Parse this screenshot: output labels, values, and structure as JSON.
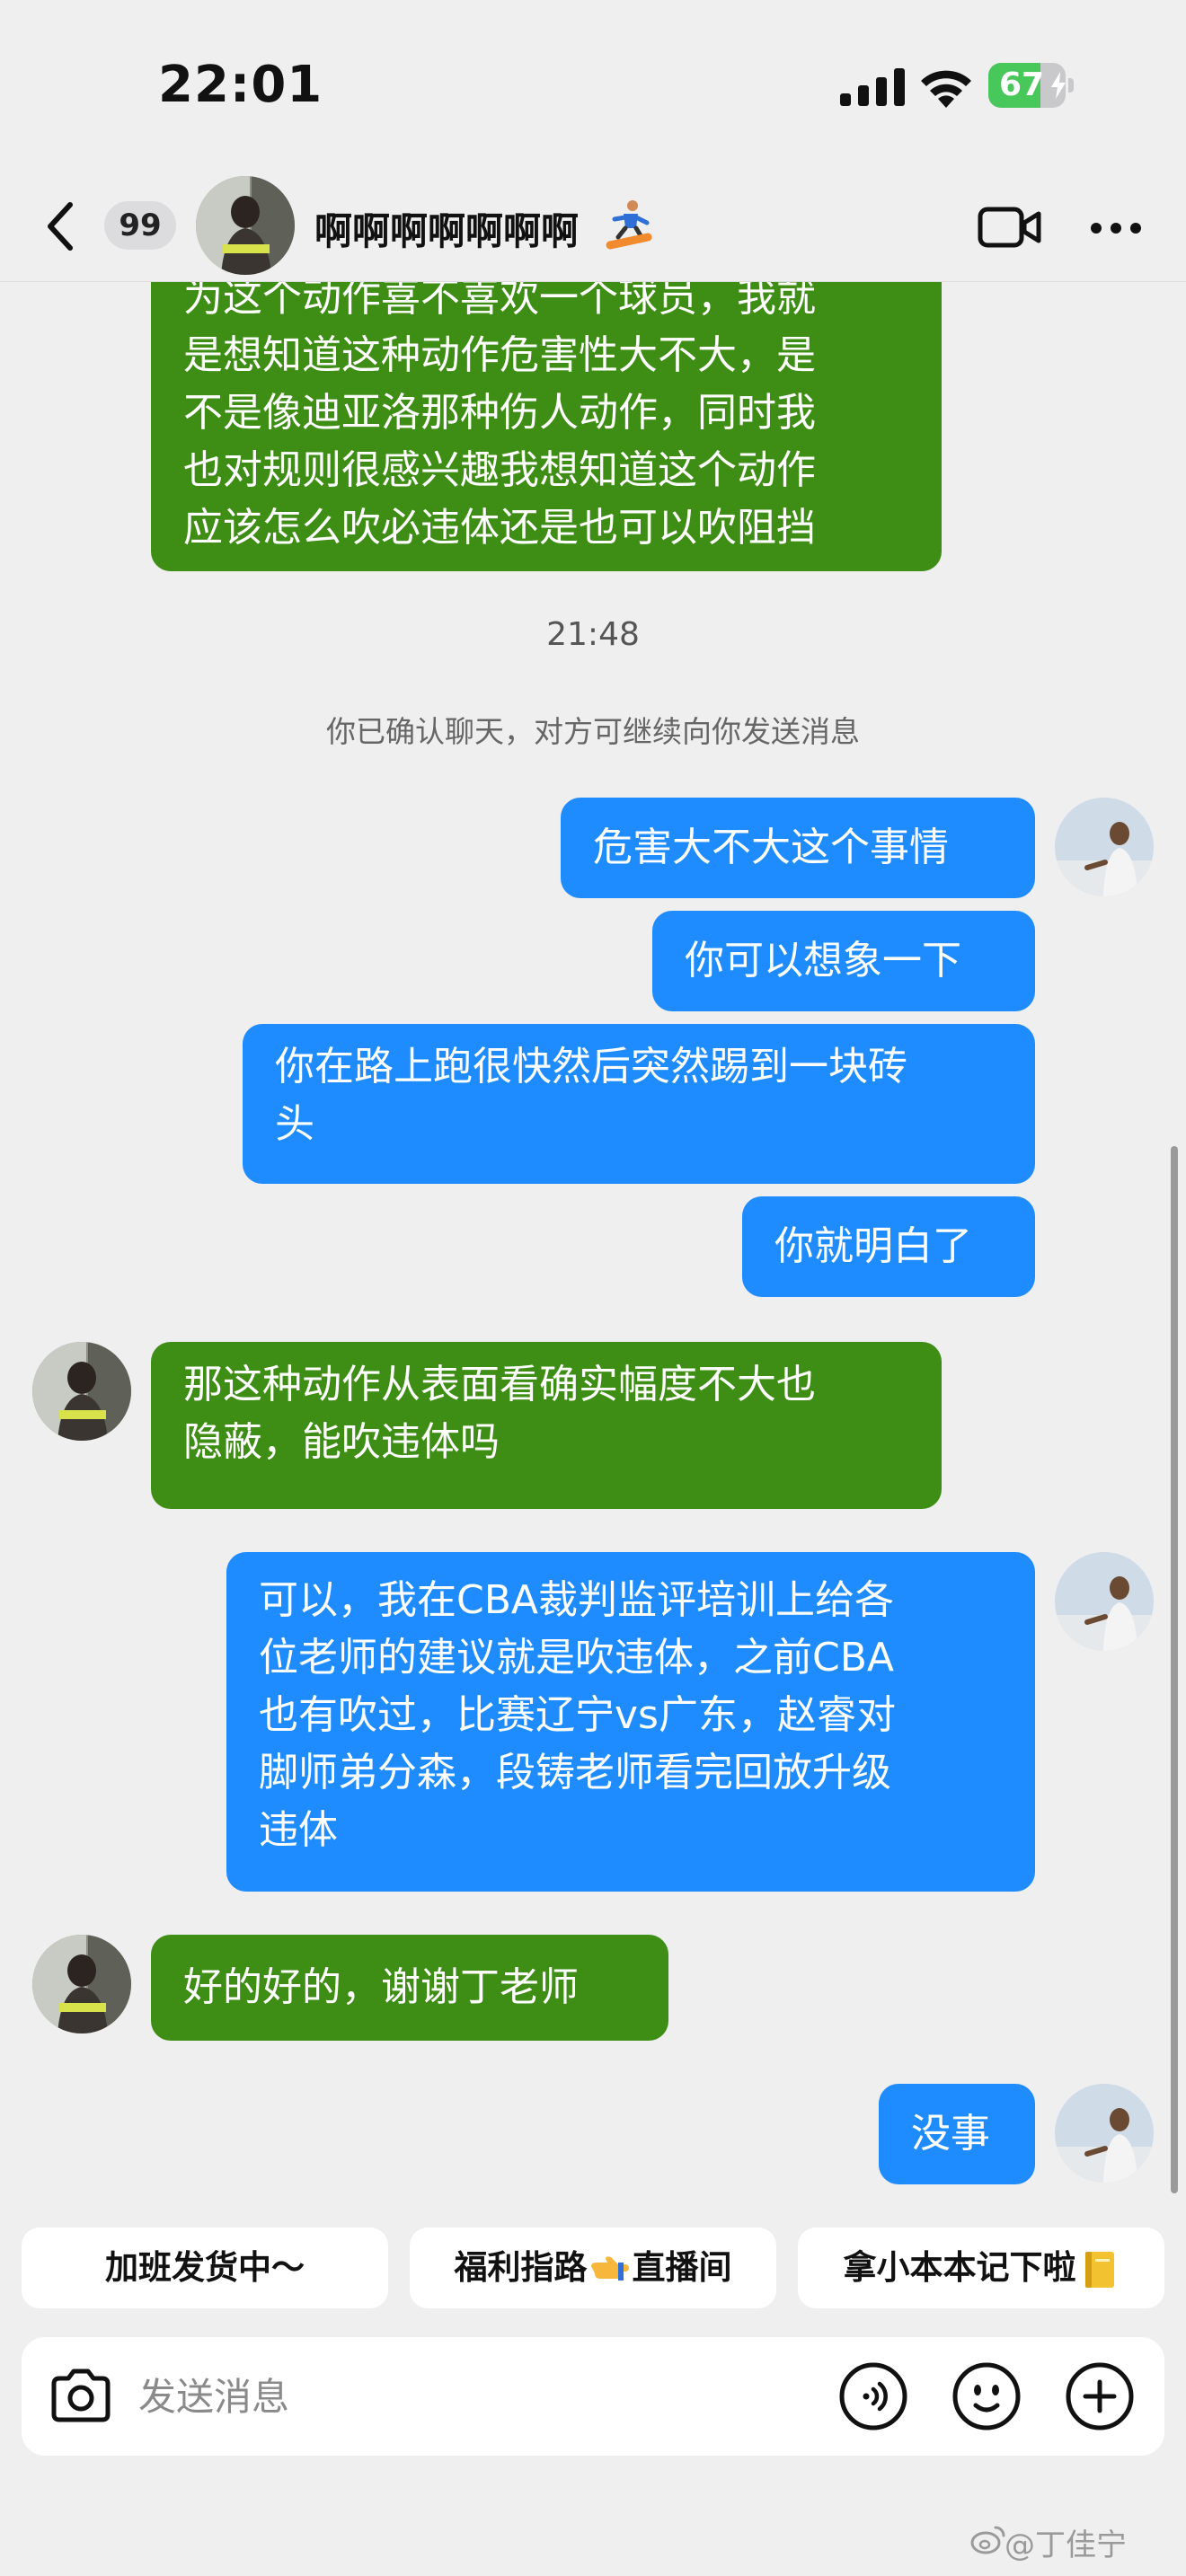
{
  "status_bar": {
    "time": "22:01",
    "battery_percent": "67",
    "battery_level": 0.67,
    "icons": [
      "signal-icon",
      "wifi-icon",
      "battery-icon"
    ]
  },
  "header": {
    "unread_count": "99",
    "contact_name": "啊啊啊啊啊啊啊",
    "icons": [
      "back-icon",
      "snowboard-icon",
      "video-call-icon",
      "more-icon"
    ]
  },
  "colors": {
    "received_bubble": "#3e8d14",
    "sent_bubble": "#1e8cff",
    "background": "#efeff0"
  },
  "chat": {
    "prev_message_lines": [
      "为这个动作喜不喜欢一个球员，我就",
      "是想知道这种动作危害性大不大，是",
      "不是像迪亚洛那种伤人动作，同时我",
      "也对规则很感兴趣我想知道这个动作",
      "应该怎么吹必违体还是也可以吹阻挡"
    ],
    "timestamp": "21:48",
    "system_note": "你已确认聊天，对方可继续向你发送消息",
    "messages": [
      {
        "sender": "me",
        "lines": [
          "危害大不大这个事情"
        ]
      },
      {
        "sender": "me",
        "lines": [
          "你可以想象一下"
        ]
      },
      {
        "sender": "me",
        "lines": [
          "你在路上跑很快然后突然踢到一块砖",
          "头"
        ]
      },
      {
        "sender": "me",
        "lines": [
          "你就明白了"
        ]
      },
      {
        "sender": "them",
        "lines": [
          "那这种动作从表面看确实幅度不大也",
          "隐蔽，能吹违体吗"
        ]
      },
      {
        "sender": "me",
        "lines": [
          "可以，我在CBA裁判监评培训上给各",
          "位老师的建议就是吹违体，之前CBA",
          "也有吹过，比赛辽宁vs广东，赵睿对",
          "脚师弟分森，段铸老师看完回放升级",
          "违体"
        ]
      },
      {
        "sender": "them",
        "lines": [
          "好的好的，谢谢丁老师"
        ]
      },
      {
        "sender": "me",
        "lines": [
          "没事"
        ]
      }
    ]
  },
  "quick_replies": [
    {
      "label": "加班发货中～"
    },
    {
      "label_before": "福利指路",
      "icon": "pointing-hand-icon",
      "label_after": "直播间"
    },
    {
      "label": "拿小本本记下啦",
      "icon": "notebook-icon"
    }
  ],
  "input": {
    "placeholder": "发送消息",
    "value": "",
    "icons": [
      "camera-icon",
      "voice-icon",
      "emoji-icon",
      "plus-icon"
    ]
  },
  "watermark": "@丁佳宁"
}
